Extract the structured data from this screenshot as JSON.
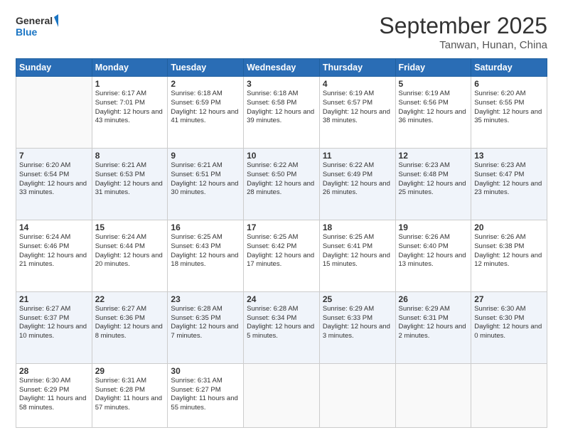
{
  "header": {
    "logo_line1": "General",
    "logo_line2": "Blue",
    "month": "September 2025",
    "location": "Tanwan, Hunan, China"
  },
  "weekdays": [
    "Sunday",
    "Monday",
    "Tuesday",
    "Wednesday",
    "Thursday",
    "Friday",
    "Saturday"
  ],
  "weeks": [
    [
      {
        "day": "",
        "sunrise": "",
        "sunset": "",
        "daylight": ""
      },
      {
        "day": "1",
        "sunrise": "Sunrise: 6:17 AM",
        "sunset": "Sunset: 7:01 PM",
        "daylight": "Daylight: 12 hours and 43 minutes."
      },
      {
        "day": "2",
        "sunrise": "Sunrise: 6:18 AM",
        "sunset": "Sunset: 6:59 PM",
        "daylight": "Daylight: 12 hours and 41 minutes."
      },
      {
        "day": "3",
        "sunrise": "Sunrise: 6:18 AM",
        "sunset": "Sunset: 6:58 PM",
        "daylight": "Daylight: 12 hours and 39 minutes."
      },
      {
        "day": "4",
        "sunrise": "Sunrise: 6:19 AM",
        "sunset": "Sunset: 6:57 PM",
        "daylight": "Daylight: 12 hours and 38 minutes."
      },
      {
        "day": "5",
        "sunrise": "Sunrise: 6:19 AM",
        "sunset": "Sunset: 6:56 PM",
        "daylight": "Daylight: 12 hours and 36 minutes."
      },
      {
        "day": "6",
        "sunrise": "Sunrise: 6:20 AM",
        "sunset": "Sunset: 6:55 PM",
        "daylight": "Daylight: 12 hours and 35 minutes."
      }
    ],
    [
      {
        "day": "7",
        "sunrise": "Sunrise: 6:20 AM",
        "sunset": "Sunset: 6:54 PM",
        "daylight": "Daylight: 12 hours and 33 minutes."
      },
      {
        "day": "8",
        "sunrise": "Sunrise: 6:21 AM",
        "sunset": "Sunset: 6:53 PM",
        "daylight": "Daylight: 12 hours and 31 minutes."
      },
      {
        "day": "9",
        "sunrise": "Sunrise: 6:21 AM",
        "sunset": "Sunset: 6:51 PM",
        "daylight": "Daylight: 12 hours and 30 minutes."
      },
      {
        "day": "10",
        "sunrise": "Sunrise: 6:22 AM",
        "sunset": "Sunset: 6:50 PM",
        "daylight": "Daylight: 12 hours and 28 minutes."
      },
      {
        "day": "11",
        "sunrise": "Sunrise: 6:22 AM",
        "sunset": "Sunset: 6:49 PM",
        "daylight": "Daylight: 12 hours and 26 minutes."
      },
      {
        "day": "12",
        "sunrise": "Sunrise: 6:23 AM",
        "sunset": "Sunset: 6:48 PM",
        "daylight": "Daylight: 12 hours and 25 minutes."
      },
      {
        "day": "13",
        "sunrise": "Sunrise: 6:23 AM",
        "sunset": "Sunset: 6:47 PM",
        "daylight": "Daylight: 12 hours and 23 minutes."
      }
    ],
    [
      {
        "day": "14",
        "sunrise": "Sunrise: 6:24 AM",
        "sunset": "Sunset: 6:46 PM",
        "daylight": "Daylight: 12 hours and 21 minutes."
      },
      {
        "day": "15",
        "sunrise": "Sunrise: 6:24 AM",
        "sunset": "Sunset: 6:44 PM",
        "daylight": "Daylight: 12 hours and 20 minutes."
      },
      {
        "day": "16",
        "sunrise": "Sunrise: 6:25 AM",
        "sunset": "Sunset: 6:43 PM",
        "daylight": "Daylight: 12 hours and 18 minutes."
      },
      {
        "day": "17",
        "sunrise": "Sunrise: 6:25 AM",
        "sunset": "Sunset: 6:42 PM",
        "daylight": "Daylight: 12 hours and 17 minutes."
      },
      {
        "day": "18",
        "sunrise": "Sunrise: 6:25 AM",
        "sunset": "Sunset: 6:41 PM",
        "daylight": "Daylight: 12 hours and 15 minutes."
      },
      {
        "day": "19",
        "sunrise": "Sunrise: 6:26 AM",
        "sunset": "Sunset: 6:40 PM",
        "daylight": "Daylight: 12 hours and 13 minutes."
      },
      {
        "day": "20",
        "sunrise": "Sunrise: 6:26 AM",
        "sunset": "Sunset: 6:38 PM",
        "daylight": "Daylight: 12 hours and 12 minutes."
      }
    ],
    [
      {
        "day": "21",
        "sunrise": "Sunrise: 6:27 AM",
        "sunset": "Sunset: 6:37 PM",
        "daylight": "Daylight: 12 hours and 10 minutes."
      },
      {
        "day": "22",
        "sunrise": "Sunrise: 6:27 AM",
        "sunset": "Sunset: 6:36 PM",
        "daylight": "Daylight: 12 hours and 8 minutes."
      },
      {
        "day": "23",
        "sunrise": "Sunrise: 6:28 AM",
        "sunset": "Sunset: 6:35 PM",
        "daylight": "Daylight: 12 hours and 7 minutes."
      },
      {
        "day": "24",
        "sunrise": "Sunrise: 6:28 AM",
        "sunset": "Sunset: 6:34 PM",
        "daylight": "Daylight: 12 hours and 5 minutes."
      },
      {
        "day": "25",
        "sunrise": "Sunrise: 6:29 AM",
        "sunset": "Sunset: 6:33 PM",
        "daylight": "Daylight: 12 hours and 3 minutes."
      },
      {
        "day": "26",
        "sunrise": "Sunrise: 6:29 AM",
        "sunset": "Sunset: 6:31 PM",
        "daylight": "Daylight: 12 hours and 2 minutes."
      },
      {
        "day": "27",
        "sunrise": "Sunrise: 6:30 AM",
        "sunset": "Sunset: 6:30 PM",
        "daylight": "Daylight: 12 hours and 0 minutes."
      }
    ],
    [
      {
        "day": "28",
        "sunrise": "Sunrise: 6:30 AM",
        "sunset": "Sunset: 6:29 PM",
        "daylight": "Daylight: 11 hours and 58 minutes."
      },
      {
        "day": "29",
        "sunrise": "Sunrise: 6:31 AM",
        "sunset": "Sunset: 6:28 PM",
        "daylight": "Daylight: 11 hours and 57 minutes."
      },
      {
        "day": "30",
        "sunrise": "Sunrise: 6:31 AM",
        "sunset": "Sunset: 6:27 PM",
        "daylight": "Daylight: 11 hours and 55 minutes."
      },
      {
        "day": "",
        "sunrise": "",
        "sunset": "",
        "daylight": ""
      },
      {
        "day": "",
        "sunrise": "",
        "sunset": "",
        "daylight": ""
      },
      {
        "day": "",
        "sunrise": "",
        "sunset": "",
        "daylight": ""
      },
      {
        "day": "",
        "sunrise": "",
        "sunset": "",
        "daylight": ""
      }
    ]
  ]
}
